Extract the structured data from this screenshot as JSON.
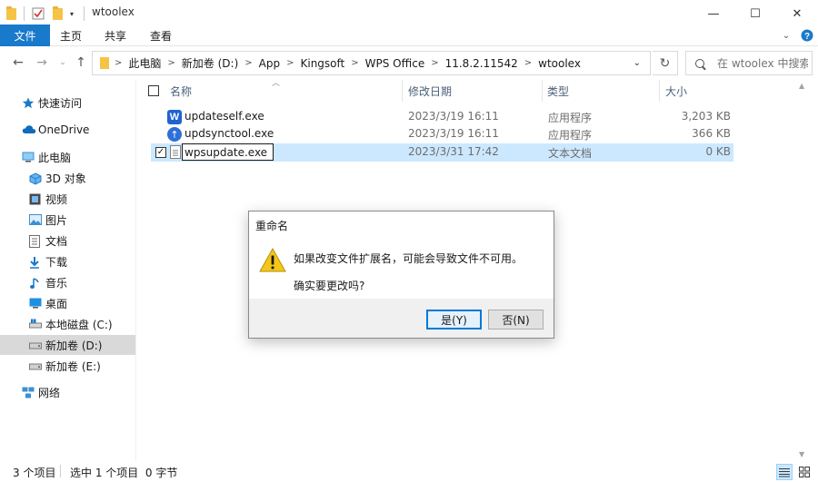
{
  "window": {
    "title": "wtoolex",
    "minimize": "—",
    "maximize": "☐",
    "close": "✕"
  },
  "ribbon": {
    "tabs": [
      "文件",
      "主页",
      "共享",
      "查看"
    ]
  },
  "address": {
    "crumbs": [
      "此电脑",
      "新加卷 (D:)",
      "App",
      "Kingsoft",
      "WPS Office",
      "11.8.2.11542",
      "wtoolex"
    ],
    "search_placeholder": "在 wtoolex 中搜索"
  },
  "nav": {
    "quick_access": "快速访问",
    "onedrive": "OneDrive",
    "this_pc": "此电脑",
    "objects3d": "3D 对象",
    "videos": "视频",
    "pictures": "图片",
    "documents": "文档",
    "downloads": "下载",
    "music": "音乐",
    "desktop": "桌面",
    "drive_c": "本地磁盘 (C:)",
    "drive_d": "新加卷 (D:)",
    "drive_e": "新加卷 (E:)",
    "network": "网络"
  },
  "columns": {
    "name": "名称",
    "date": "修改日期",
    "type": "类型",
    "size": "大小"
  },
  "files": [
    {
      "name": "updateself.exe",
      "date": "2023/3/19 16:11",
      "type": "应用程序",
      "size": "3,203 KB",
      "icon": "wps-app-icon"
    },
    {
      "name": "updsynctool.exe",
      "date": "2023/3/19 16:11",
      "type": "应用程序",
      "size": "366 KB",
      "icon": "sync-app-icon"
    },
    {
      "name": "wpsupdate.exe",
      "date": "2023/3/31 17:42",
      "type": "文本文档",
      "size": "0 KB",
      "icon": "text-file-icon"
    }
  ],
  "status": {
    "count": "3 个项目",
    "selection": "选中 1 个项目  0 字节"
  },
  "dialog": {
    "title": "重命名",
    "message": "如果改变文件扩展名，可能会导致文件不可用。",
    "question": "确实要更改吗?",
    "yes": "是(Y)",
    "no": "否(N)"
  },
  "colors": {
    "accent": "#1979ca",
    "selection": "#cce8ff",
    "warning": "#f5c518"
  }
}
